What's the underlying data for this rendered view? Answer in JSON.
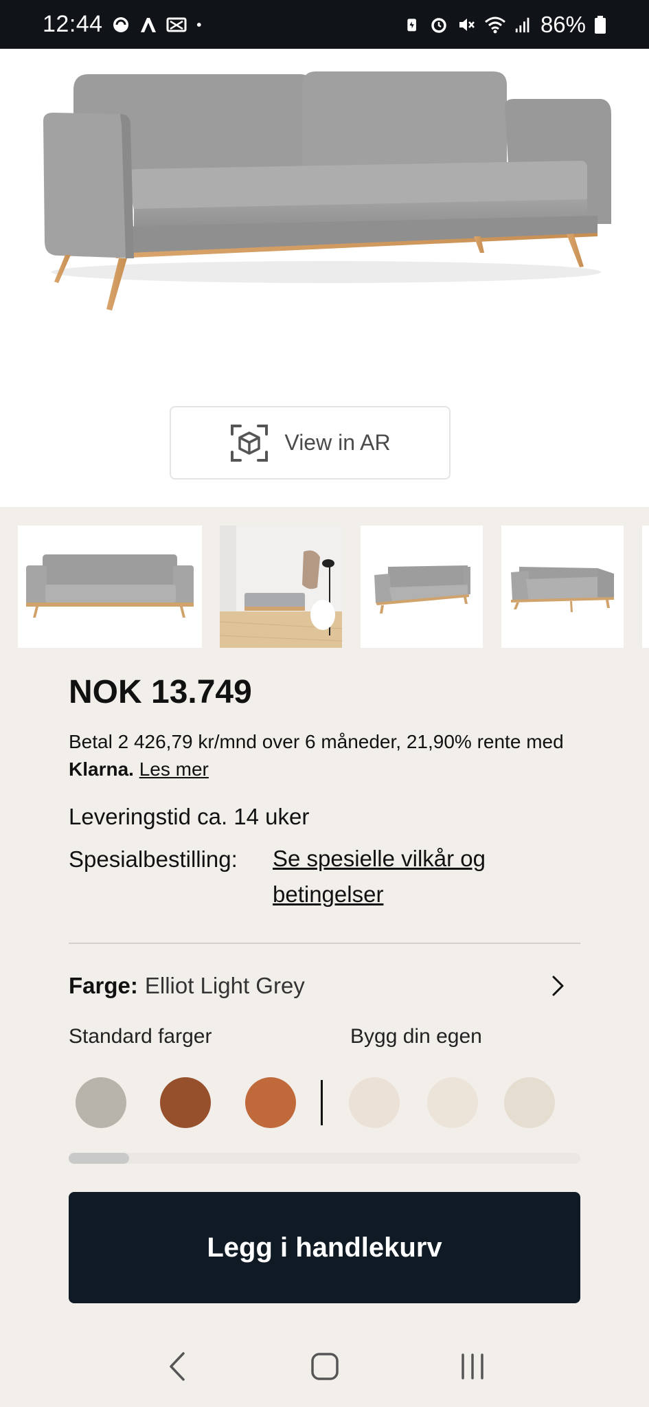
{
  "status_bar": {
    "time": "12:44",
    "battery": "86%",
    "left_icons": [
      "sync-icon",
      "app-icon",
      "notification-icon",
      "dot-icon"
    ],
    "right_icons": [
      "battery-saver-icon",
      "alarm-icon",
      "mute-icon",
      "wifi-icon",
      "signal-icon",
      "battery-icon"
    ]
  },
  "hero": {
    "ar_button_label": "View in AR"
  },
  "thumbnails": [
    "sofa-front",
    "sofa-room",
    "sofa-angle-left",
    "sofa-angle-right"
  ],
  "product": {
    "price": "NOK 13.749",
    "klarna_text": "Betal 2 426,79 kr/mnd over 6 måneder, 21,90% rente med",
    "klarna_brand": "Klarna.",
    "klarna_link": "Les mer",
    "delivery": "Leveringstid ca. 14 uker",
    "special_label": "Spesialbestilling:",
    "special_link": "Se spesielle vilkår og betingelser"
  },
  "color_selector": {
    "key": "Farge:",
    "value": "Elliot Light Grey",
    "standard_label": "Standard farger",
    "custom_label": "Bygg din egen",
    "standard_swatches": [
      "#b8b3ab",
      "#97502c",
      "#c0693a"
    ],
    "custom_swatches": [
      "#ece1d6",
      "#ece4d8",
      "#e6ddd1"
    ]
  },
  "cart": {
    "button_label": "Legg i handlekurv"
  },
  "colors": {
    "status_bar_bg": "#101419",
    "page_bg": "#f2efeb",
    "button_dark": "#0f1a24"
  }
}
